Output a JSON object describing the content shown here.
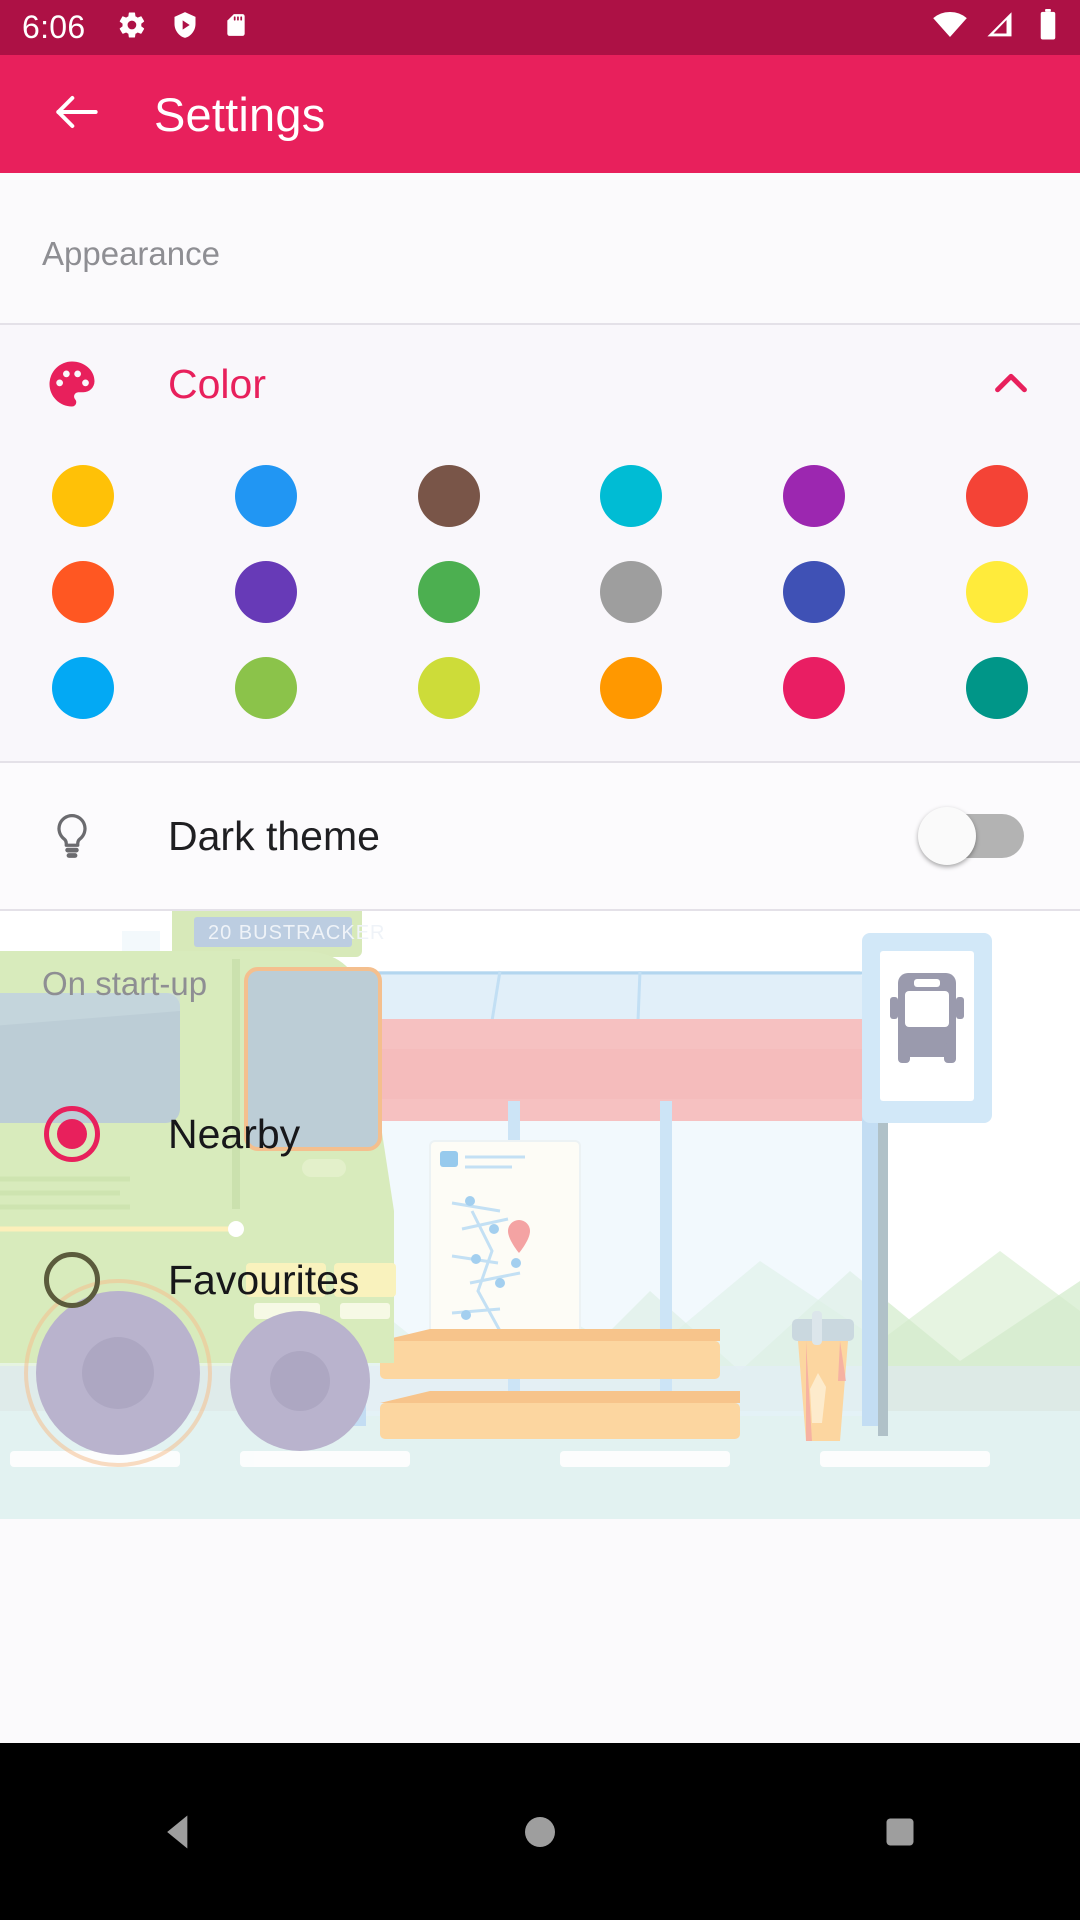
{
  "status_bar": {
    "time": "6:06",
    "left_icons": [
      "gear-icon",
      "shield-play-icon",
      "sd-card-icon"
    ],
    "right_icons": [
      "wifi-icon",
      "cellular-signal-icon",
      "battery-icon"
    ],
    "background_color": "#ad1145"
  },
  "app_bar": {
    "back_icon": "arrow-left-icon",
    "title": "Settings",
    "background_color": "#e8205c"
  },
  "sections": {
    "appearance": {
      "header": "Appearance",
      "color_item": {
        "icon": "palette-icon",
        "label": "Color",
        "expanded": true,
        "chevron_icon": "chevron-up-icon",
        "accent_color": "#e8205c"
      },
      "swatch_rows": [
        [
          {
            "name": "amber",
            "hex": "#ffc107"
          },
          {
            "name": "blue",
            "hex": "#2196f3"
          },
          {
            "name": "brown",
            "hex": "#795548"
          },
          {
            "name": "cyan",
            "hex": "#00bcd4"
          },
          {
            "name": "purple",
            "hex": "#9c27b0"
          },
          {
            "name": "red",
            "hex": "#f44336"
          }
        ],
        [
          {
            "name": "deep-orange",
            "hex": "#ff5722"
          },
          {
            "name": "deep-purple",
            "hex": "#673ab7"
          },
          {
            "name": "green",
            "hex": "#4caf50"
          },
          {
            "name": "grey",
            "hex": "#9e9e9e"
          },
          {
            "name": "indigo",
            "hex": "#3f51b5"
          },
          {
            "name": "yellow",
            "hex": "#ffeb3b"
          }
        ],
        [
          {
            "name": "light-blue",
            "hex": "#03a9f4"
          },
          {
            "name": "light-green",
            "hex": "#8bc34a"
          },
          {
            "name": "lime",
            "hex": "#cddc39"
          },
          {
            "name": "orange",
            "hex": "#ff9800"
          },
          {
            "name": "pink",
            "hex": "#e91e63"
          },
          {
            "name": "teal",
            "hex": "#009688"
          }
        ]
      ],
      "dark_theme": {
        "icon": "lightbulb-icon",
        "label": "Dark theme",
        "enabled": false
      }
    },
    "startup": {
      "header": "On start-up",
      "options": [
        {
          "label": "Nearby",
          "selected": true
        },
        {
          "label": "Favourites",
          "selected": false
        }
      ]
    }
  },
  "illustration": {
    "bus_sign_text": "BUSTRACKER",
    "bus_route_number": "20"
  },
  "nav_bar": {
    "buttons": [
      "back-nav-icon",
      "home-nav-icon",
      "recents-nav-icon"
    ],
    "background_color": "#000000"
  }
}
